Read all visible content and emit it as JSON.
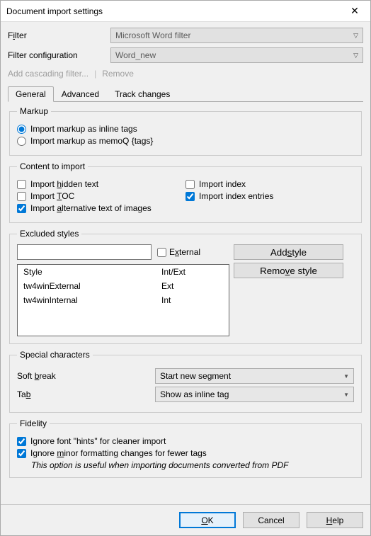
{
  "title": "Document import settings",
  "filter": {
    "label_pre": "F",
    "label_u": "i",
    "label_post": "lter",
    "value": "Microsoft Word filter"
  },
  "filter_config": {
    "label": "Filter configuration",
    "value": "Word_new"
  },
  "links": {
    "add_cascading": "Add cascading filter...",
    "remove": "Remove"
  },
  "tabs": {
    "general": "General",
    "advanced": "Advanced",
    "track": "Track changes"
  },
  "markup": {
    "legend": "Markup",
    "opt_inline": "Import markup as inline tags",
    "opt_memoq": "Import markup as memoQ {tags}"
  },
  "content": {
    "legend": "Content to import",
    "hidden": {
      "pre": "Import ",
      "u": "h",
      "post": "idden text"
    },
    "toc": {
      "pre": "Import ",
      "u": "T",
      "post": "OC"
    },
    "alt": {
      "pre": "Import ",
      "u": "a",
      "post": "lternative text of images"
    },
    "index": "Import index",
    "index_entries": "Import index entries"
  },
  "excluded": {
    "legend": "Excluded styles",
    "external": {
      "pre": "E",
      "u": "x",
      "post": "ternal"
    },
    "add": {
      "pre": "Add ",
      "u": "s",
      "post": "tyle"
    },
    "remove": {
      "pre": "Remo",
      "u": "v",
      "post": "e style"
    },
    "col_style": "Style",
    "col_intext": "Int/Ext",
    "rows": [
      {
        "style": "tw4winExternal",
        "ie": "Ext"
      },
      {
        "style": "tw4winInternal",
        "ie": "Int"
      }
    ]
  },
  "special": {
    "legend": "Special characters",
    "softbreak": {
      "pre": "Soft ",
      "u": "b",
      "post": "reak"
    },
    "softbreak_val": "Start new segment",
    "tab": {
      "pre": "Ta",
      "u": "b",
      "post": ""
    },
    "tab_val": "Show as inline tag"
  },
  "fidelity": {
    "legend": "Fidelity",
    "hints": "Ignore font \"hints\" for cleaner import",
    "minor": {
      "pre": "Ignore ",
      "u": "m",
      "post": "inor formatting changes for fewer tags"
    },
    "note": "This option is useful when importing documents converted from PDF"
  },
  "buttons": {
    "ok": {
      "pre": "",
      "u": "O",
      "post": "K"
    },
    "cancel": "Cancel",
    "help": {
      "pre": "",
      "u": "H",
      "post": "elp"
    }
  }
}
